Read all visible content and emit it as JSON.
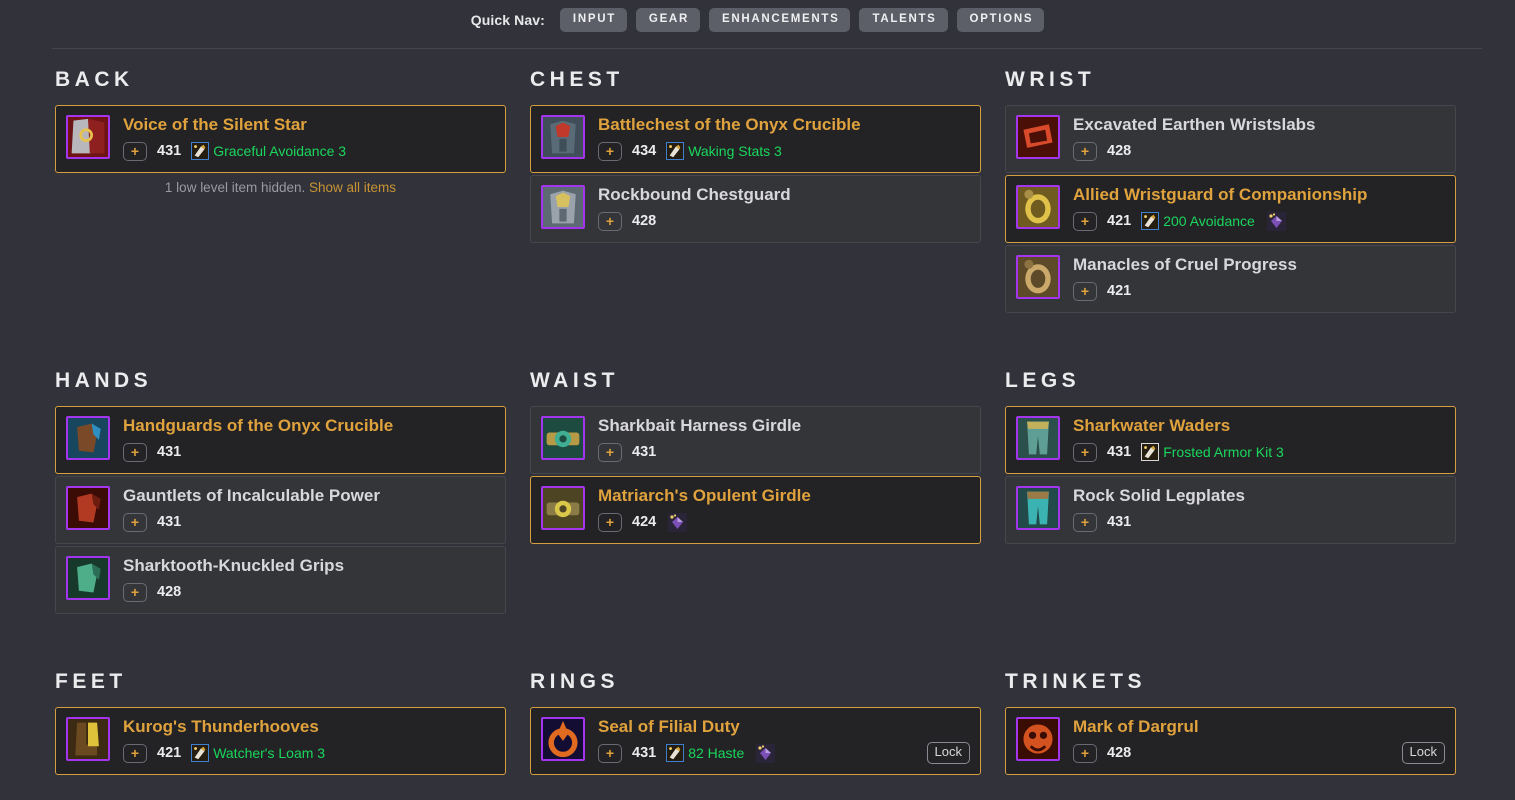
{
  "quick_nav": {
    "label": "Quick Nav:",
    "buttons": [
      {
        "label": "INPUT"
      },
      {
        "label": "GEAR"
      },
      {
        "label": "ENHANCEMENTS"
      },
      {
        "label": "TALENTS"
      },
      {
        "label": "OPTIONS"
      }
    ]
  },
  "colors": {
    "background": "#32333a",
    "card_background": "#343539",
    "card_selected_background": "#232326",
    "selected_border": "#d79e3f",
    "item_quality_epic": "#a335ee",
    "selected_name": "#e0a23c",
    "enchant_text": "#1ad65c",
    "ilvl_text": "#ececee",
    "muted_text": "#9a9aa2",
    "link": "#c89334"
  },
  "sections": [
    {
      "title": "BACK",
      "items": [
        {
          "name": "Voice of the Silent Star",
          "ilvl": "431",
          "selected": true,
          "add_label": "+",
          "enchant": "Graceful Avoidance 3",
          "gem": false,
          "lock": null
        }
      ],
      "hidden_note": {
        "text": "1 low level item hidden.",
        "link": "Show all items"
      }
    },
    {
      "title": "CHEST",
      "items": [
        {
          "name": "Battlechest of the Onyx Crucible",
          "ilvl": "434",
          "selected": true,
          "add_label": "+",
          "enchant": "Waking Stats 3",
          "gem": false,
          "lock": null
        },
        {
          "name": "Rockbound Chestguard",
          "ilvl": "428",
          "selected": false,
          "add_label": "+",
          "enchant": null,
          "gem": false,
          "lock": null
        }
      ],
      "hidden_note": null
    },
    {
      "title": "WRIST",
      "items": [
        {
          "name": "Excavated Earthen Wristslabs",
          "ilvl": "428",
          "selected": false,
          "add_label": "+",
          "enchant": null,
          "gem": false,
          "lock": null
        },
        {
          "name": "Allied Wristguard of Companionship",
          "ilvl": "421",
          "selected": true,
          "add_label": "+",
          "enchant": "200 Avoidance",
          "gem": true,
          "lock": null
        },
        {
          "name": "Manacles of Cruel Progress",
          "ilvl": "421",
          "selected": false,
          "add_label": "+",
          "enchant": null,
          "gem": false,
          "lock": null
        }
      ],
      "hidden_note": null
    },
    {
      "title": "HANDS",
      "items": [
        {
          "name": "Handguards of the Onyx Crucible",
          "ilvl": "431",
          "selected": true,
          "add_label": "+",
          "enchant": null,
          "gem": false,
          "lock": null
        },
        {
          "name": "Gauntlets of Incalculable Power",
          "ilvl": "431",
          "selected": false,
          "add_label": "+",
          "enchant": null,
          "gem": false,
          "lock": null
        },
        {
          "name": "Sharktooth-Knuckled Grips",
          "ilvl": "428",
          "selected": false,
          "add_label": "+",
          "enchant": null,
          "gem": false,
          "lock": null
        }
      ],
      "hidden_note": null
    },
    {
      "title": "WAIST",
      "items": [
        {
          "name": "Sharkbait Harness Girdle",
          "ilvl": "431",
          "selected": false,
          "add_label": "+",
          "enchant": null,
          "gem": false,
          "lock": null
        },
        {
          "name": "Matriarch's Opulent Girdle",
          "ilvl": "424",
          "selected": true,
          "add_label": "+",
          "enchant": null,
          "gem": true,
          "lock": null
        }
      ],
      "hidden_note": null
    },
    {
      "title": "LEGS",
      "items": [
        {
          "name": "Sharkwater Waders",
          "ilvl": "431",
          "selected": true,
          "add_label": "+",
          "enchant": "Frosted Armor Kit 3",
          "enchant_icon_plain": true,
          "gem": false,
          "lock": null
        },
        {
          "name": "Rock Solid Legplates",
          "ilvl": "431",
          "selected": false,
          "add_label": "+",
          "enchant": null,
          "gem": false,
          "lock": null
        }
      ],
      "hidden_note": null
    },
    {
      "title": "FEET",
      "items": [
        {
          "name": "Kurog's Thunderhooves",
          "ilvl": "421",
          "selected": true,
          "add_label": "+",
          "enchant": "Watcher's Loam 3",
          "gem": false,
          "lock": null
        }
      ],
      "hidden_note": null
    },
    {
      "title": "RINGS",
      "items": [
        {
          "name": "Seal of Filial Duty",
          "ilvl": "431",
          "selected": true,
          "add_label": "+",
          "enchant": "82 Haste",
          "gem": true,
          "lock": "Lock"
        }
      ],
      "hidden_note": null
    },
    {
      "title": "TRINKETS",
      "items": [
        {
          "name": "Mark of Dargrul",
          "ilvl": "428",
          "selected": true,
          "add_label": "+",
          "enchant": null,
          "gem": false,
          "lock": "Lock"
        }
      ],
      "hidden_note": null
    }
  ]
}
